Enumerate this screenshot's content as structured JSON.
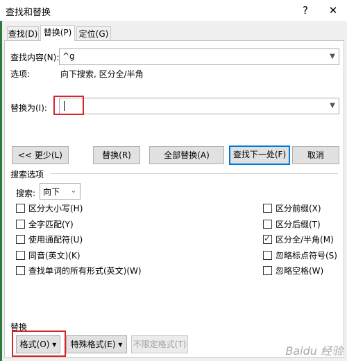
{
  "window": {
    "title": "查找和替换",
    "help": "?",
    "close": "✕"
  },
  "tabs": [
    {
      "label": "查找(D)"
    },
    {
      "label": "替换(P)"
    },
    {
      "label": "定位(G)"
    }
  ],
  "find": {
    "label": "查找内容(N):",
    "value": "^g"
  },
  "options": {
    "label": "选项:",
    "value": "向下搜索, 区分全/半角"
  },
  "replace": {
    "label": "替换为(I):",
    "value": ""
  },
  "buttons": {
    "less": "<< 更少(L)",
    "replace": "替换(R)",
    "replace_all": "全部替换(A)",
    "find_next": "查找下一处(F)",
    "cancel": "取消"
  },
  "search_options": {
    "section_label": "搜索选项",
    "search_label": "搜索:",
    "search_value": "向下",
    "left": [
      {
        "label": "区分大小写(H)",
        "checked": false
      },
      {
        "label": "全字匹配(Y)",
        "checked": false
      },
      {
        "label": "使用通配符(U)",
        "checked": false
      },
      {
        "label": "同音(英文)(K)",
        "checked": false
      },
      {
        "label": "查找单词的所有形式(英文)(W)",
        "checked": false
      }
    ],
    "right": [
      {
        "label": "区分前缀(X)",
        "checked": false
      },
      {
        "label": "区分后缀(T)",
        "checked": false
      },
      {
        "label": "区分全/半角(M)",
        "checked": true
      },
      {
        "label": "忽略标点符号(S)",
        "checked": false
      },
      {
        "label": "忽略空格(W)",
        "checked": false
      }
    ]
  },
  "replace_section": {
    "label": "替换",
    "format": "格式(O) ▾",
    "special": "特殊格式(E) ▾",
    "no_format": "不限定格式(T)"
  },
  "watermark": "Baidu 经验",
  "colors": {
    "highlight": "#d9232d",
    "accent": "#0078d7"
  }
}
